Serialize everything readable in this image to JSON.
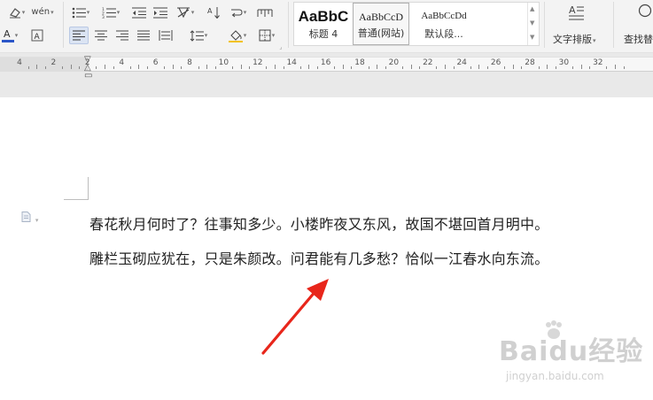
{
  "toolbar": {
    "phonetic_glyph": "wén",
    "styles": [
      {
        "preview": "AaBbC",
        "label": "标题 4"
      },
      {
        "preview": "AaBbCcD",
        "label": "普通(网站)"
      },
      {
        "preview": "AaBbCcDd",
        "label": "默认段..."
      }
    ],
    "text_layout_label": "文字排版",
    "find_replace_label": "查找替"
  },
  "ruler": {
    "numbers": [
      "4",
      "2",
      "2",
      "4",
      "6",
      "8",
      "10",
      "12",
      "14",
      "16",
      "18",
      "20",
      "22",
      "24",
      "26",
      "28",
      "30",
      "32"
    ]
  },
  "document": {
    "lines": [
      "春花秋月何时了？往事知多少。小楼昨夜又东风，故国不堪回首月明中。",
      "雕栏玉砌应犹在，只是朱颜改。问君能有几多愁？恰似一江春水向东流。"
    ]
  },
  "watermark": {
    "brand": "Baidu经验",
    "site": "jingyan.baidu.com"
  },
  "colors": {
    "font_color_underline": "#2b56c8",
    "highlight_yellow": "#f2c218",
    "arrow_red": "#e8261b"
  }
}
